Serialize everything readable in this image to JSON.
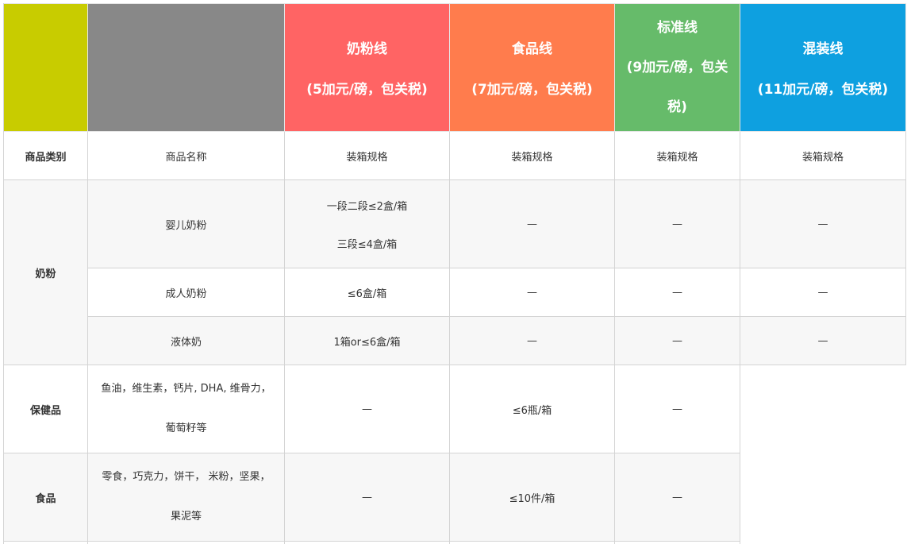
{
  "colors": {
    "corner": "#c8cc00",
    "name_header": "#888888",
    "milk_line": "#ff6464",
    "food_line": "#ff7c4d",
    "standard_line": "#66bb6a",
    "mixed_line": "#0ea0e0"
  },
  "header": {
    "milk_line": {
      "title": "奶粉线",
      "price": "(5加元/磅，包关税)"
    },
    "food_line": {
      "title": "食品线",
      "price": "(7加元/磅，包关税)"
    },
    "standard_line": {
      "title": "标准线",
      "price_line1": "(9加元/磅，包关",
      "price_line2": "税)"
    },
    "mixed_line": {
      "title": "混装线",
      "price": "(11加元/磅，包关税)"
    }
  },
  "columns": {
    "category": "商品类别",
    "name": "商品名称",
    "spec1": "装箱规格",
    "spec2": "装箱规格",
    "spec3": "装箱规格",
    "spec4": "装箱规格"
  },
  "rows": {
    "milk_powder": {
      "category": "奶粉",
      "infant": {
        "name": "婴儿奶粉",
        "milk_line_1": "一段二段≤2盒/箱",
        "milk_line_2": "三段≤4盒/箱",
        "food_line": "—",
        "standard_line": "—",
        "mixed_line": "—"
      },
      "adult": {
        "name": "成人奶粉",
        "milk_line": "≤6盒/箱",
        "food_line": "—",
        "standard_line": "—",
        "mixed_line": "—"
      },
      "liquid": {
        "name": "液体奶",
        "milk_line": "1箱or≤6盒/箱",
        "food_line": "—",
        "standard_line": "—",
        "mixed_line": "—"
      }
    },
    "health": {
      "category": "保健品",
      "name_line1": "鱼油，维生素，钙片, DHA, 维骨力，",
      "name_line2": "葡萄籽等",
      "milk_line": "—",
      "food_line": "≤6瓶/箱",
      "standard_line": "—"
    },
    "food": {
      "category": "食品",
      "name_line1": "零食，巧克力，饼干， 米粉，坚果，",
      "name_line2": "果泥等",
      "milk_line": "—",
      "food_line": "≤10件/箱",
      "standard_line": "—"
    }
  }
}
